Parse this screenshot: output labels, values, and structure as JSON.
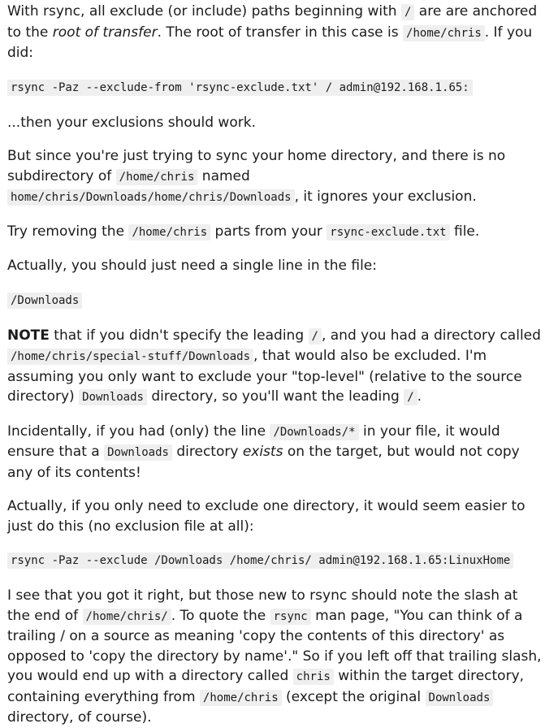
{
  "p1": {
    "t1": "With rsync, all exclude (or include) paths beginning with ",
    "c1": "/",
    "t2": " are are anchored to the ",
    "em1": "root of transfer",
    "t3": ". The root of transfer in this case is ",
    "c2": "/home/chris",
    "t4": ". If you did:"
  },
  "code1": "rsync -Paz --exclude-from 'rsync-exclude.txt' / admin@192.168.1.65:",
  "p2": {
    "t1": "...then your exclusions should work."
  },
  "p3": {
    "t1": "But since you're just trying to sync your home directory, and there is no subdirectory of ",
    "c1": "/home/chris",
    "t2": " named ",
    "c2": "home/chris/Downloads/home/chris/Downloads",
    "t3": ", it ignores your exclusion."
  },
  "p4": {
    "t1": "Try removing the ",
    "c1": "/home/chris",
    "t2": " parts from your ",
    "c2": "rsync-exclude.txt",
    "t3": " file."
  },
  "p5": {
    "t1": "Actually, you should just need a single line in the file:"
  },
  "code2": "/Downloads",
  "p6": {
    "strong1": "NOTE",
    "t1": " that if you didn't specify the leading ",
    "c1": "/",
    "t2": ", and you had a directory called ",
    "c2": "/home/chris/special-stuff/Downloads",
    "t3": ", that would also be excluded. I'm assuming you only want to exclude your \"top-level\" (relative to the source directory) ",
    "c3": "Downloads",
    "t4": " directory, so you'll want the leading ",
    "c4": "/",
    "t5": "."
  },
  "p7": {
    "t1": "Incidentally, if you had (only) the line ",
    "c1": "/Downloads/*",
    "t2": " in your file, it would ensure that a ",
    "c2": "Downloads",
    "t3": " directory ",
    "em1": "exists",
    "t4": " on the target, but would not copy any of its contents!"
  },
  "p8": {
    "t1": "Actually, if you only need to exclude one directory, it would seem easier to just do this (no exclusion file at all):"
  },
  "code3": "rsync -Paz --exclude /Downloads /home/chris/ admin@192.168.1.65:LinuxHome",
  "p9": {
    "t1": "I see that you got it right, but those new to rsync should note the slash at the end of ",
    "c1": "/home/chris/",
    "t2": ". To quote the ",
    "c2": "rsync",
    "t3": " man page, \"You can think of a trailing / on a source as meaning 'copy the contents of this directory' as opposed to 'copy the directory by name'.\" So if you left off that trailing slash, you would end up with a directory called ",
    "c3": "chris",
    "t4": " within the target directory, containing everything from ",
    "c4": "/home/chris",
    "t5": " (except the original ",
    "c5": "Downloads",
    "t6": " directory, of course)."
  }
}
